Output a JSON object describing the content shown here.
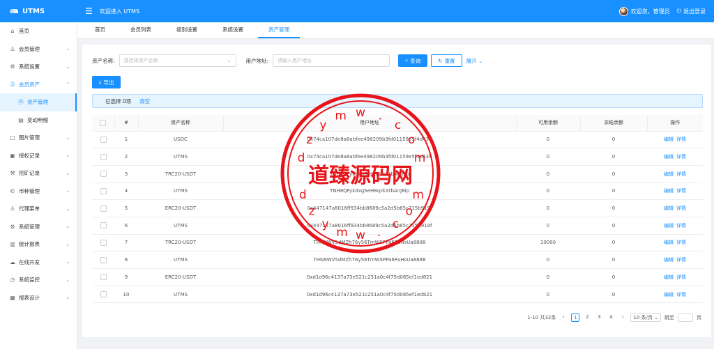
{
  "app": {
    "name": "UTMS",
    "welcome": "欢迎进入 UTMS"
  },
  "user": {
    "greeting": "欢迎您，管理员",
    "logout": "退出登录"
  },
  "sidebar": {
    "items": [
      {
        "label": "首页",
        "icon": "home-icon"
      },
      {
        "label": "会员管理",
        "icon": "user-icon"
      },
      {
        "label": "系统设置",
        "icon": "gear-icon"
      },
      {
        "label": "会员资产",
        "icon": "dollar-icon"
      },
      {
        "label": "资产管理",
        "icon": "dollar-icon"
      },
      {
        "label": "变动明细",
        "icon": "list-icon"
      },
      {
        "label": "图片管理",
        "icon": "image-icon"
      },
      {
        "label": "授权记录",
        "icon": "picture-icon"
      },
      {
        "label": "挖矿记录",
        "icon": "pickaxe-icon"
      },
      {
        "label": "币种管理",
        "icon": "coin-icon"
      },
      {
        "label": "代理菜单",
        "icon": "user-icon"
      },
      {
        "label": "系统管理",
        "icon": "gear-icon"
      },
      {
        "label": "统计报表",
        "icon": "chart-icon"
      },
      {
        "label": "在线开发",
        "icon": "cloud-icon"
      },
      {
        "label": "系统监控",
        "icon": "monitor-icon"
      },
      {
        "label": "报表设计",
        "icon": "report-icon"
      }
    ]
  },
  "tabs": [
    "首页",
    "会员列表",
    "级别设置",
    "系统设置",
    "资产管理"
  ],
  "filters": {
    "asset_label": "资产名称:",
    "asset_placeholder": "请选择资产名称",
    "addr_label": "用户地址:",
    "addr_placeholder": "请输入用户地址",
    "search": "查询",
    "reset": "重置",
    "expand": "展开"
  },
  "export_label": "导出",
  "alert": {
    "selected": "已选择 0项",
    "clear": "清空"
  },
  "table": {
    "headers": [
      "#",
      "资产名称",
      "用户地址",
      "可用余额",
      "冻结余额",
      "操作"
    ],
    "rows": [
      {
        "no": "1",
        "asset": "USDC",
        "addr": "0x74ca107de8a8abfee498209b3fd01159e5f4d439",
        "avail": "0",
        "frozen": "0"
      },
      {
        "no": "2",
        "asset": "UTMS",
        "addr": "0x74ca107de8a8abfee498209b3fd01159e5f4d439",
        "avail": "0",
        "frozen": "0"
      },
      {
        "no": "3",
        "asset": "TRC20-USDT",
        "addr": "TNH8QFykdxgSeH8qzkXtbAnJ8ip",
        "avail": "0",
        "frozen": "0"
      },
      {
        "no": "4",
        "asset": "UTMS",
        "addr": "TNH8QFykdxgSeH8qzkXtbAnJ8ip",
        "avail": "0",
        "frozen": "0"
      },
      {
        "no": "5",
        "asset": "ERC20-USDT",
        "addr": "0x447147a8016ff934bb8689c5a2d5b65c715b919f",
        "avail": "0",
        "frozen": "0"
      },
      {
        "no": "6",
        "asset": "UTMS",
        "addr": "0x447147a8016ff934bb8689c5a2d5b65c715b919f",
        "avail": "0",
        "frozen": "0"
      },
      {
        "no": "7",
        "asset": "TRC20-USDT",
        "addr": "THN9WV5dMZh76y56TmWSPPa6RsHsUa8888",
        "avail": "10000",
        "frozen": "0"
      },
      {
        "no": "8",
        "asset": "UTMS",
        "addr": "THN9WV5dMZh76y56TmWSPPa6RsHsUa8888",
        "avail": "0",
        "frozen": "0"
      },
      {
        "no": "9",
        "asset": "ERC20-USDT",
        "addr": "0xd1d96c4137a73e521c251a0c4f75d085ef1ed821",
        "avail": "0",
        "frozen": "0"
      },
      {
        "no": "10",
        "asset": "UTMS",
        "addr": "0xd1d96c4137a73e521c251a0c4f75d085ef1ed821",
        "avail": "0",
        "frozen": "0"
      }
    ],
    "edit": "编辑",
    "detail": "详情"
  },
  "pagination": {
    "summary": "1-10 共32条",
    "pages": [
      "1",
      "2",
      "3",
      "4"
    ],
    "current": "1",
    "page_size": "10 条/页",
    "jump_label": "跳至",
    "page_unit": "页"
  },
  "watermark": {
    "text": "道臻源码网",
    "ring": "dzymw.com",
    "color": "#e8141a"
  }
}
